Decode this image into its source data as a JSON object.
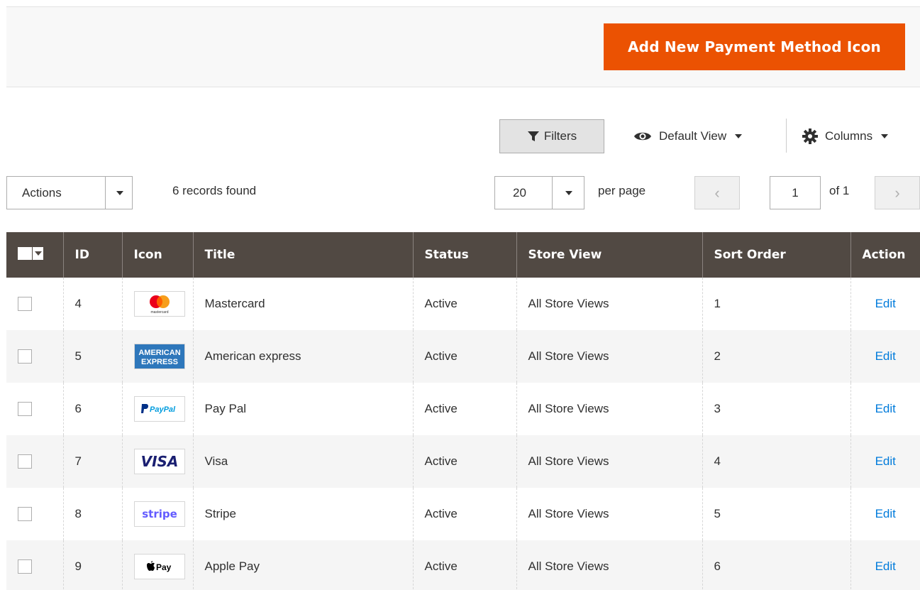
{
  "header": {
    "add_button_label": "Add New Payment Method Icon"
  },
  "toolbar": {
    "filters_label": "Filters",
    "view_label": "Default View",
    "columns_label": "Columns"
  },
  "grid_controls": {
    "actions_label": "Actions",
    "records_found": "6 records found",
    "per_page_value": "20",
    "per_page_label": "per page",
    "current_page": "1",
    "page_total": "of 1",
    "prev_glyph": "‹",
    "next_glyph": "›"
  },
  "table": {
    "columns": [
      "ID",
      "Icon",
      "Title",
      "Status",
      "Store View",
      "Sort Order",
      "Action"
    ],
    "rows": [
      {
        "id": "4",
        "icon": "mastercard-logo",
        "title": "Mastercard",
        "status": "Active",
        "store_view": "All Store Views",
        "sort_order": "1",
        "action": "Edit"
      },
      {
        "id": "5",
        "icon": "amex-logo",
        "title": "American express",
        "status": "Active",
        "store_view": "All Store Views",
        "sort_order": "2",
        "action": "Edit"
      },
      {
        "id": "6",
        "icon": "paypal-logo",
        "title": "Pay Pal",
        "status": "Active",
        "store_view": "All Store Views",
        "sort_order": "3",
        "action": "Edit"
      },
      {
        "id": "7",
        "icon": "visa-logo",
        "title": "Visa",
        "status": "Active",
        "store_view": "All Store Views",
        "sort_order": "4",
        "action": "Edit"
      },
      {
        "id": "8",
        "icon": "stripe-logo",
        "title": "Stripe",
        "status": "Active",
        "store_view": "All Store Views",
        "sort_order": "5",
        "action": "Edit"
      },
      {
        "id": "9",
        "icon": "apple-pay-logo",
        "title": "Apple Pay",
        "status": "Active",
        "store_view": "All Store Views",
        "sort_order": "6",
        "action": "Edit"
      }
    ]
  },
  "logos": {
    "mastercard": "mastercard",
    "amex_line1": "AMERICAN",
    "amex_line2": "EXPRESS",
    "paypal": "PayPal",
    "visa": "VISA",
    "stripe": "stripe",
    "applepay": "Pay"
  },
  "colors": {
    "accent": "#eb5202",
    "header_bg": "#514943",
    "link": "#007bdb"
  }
}
